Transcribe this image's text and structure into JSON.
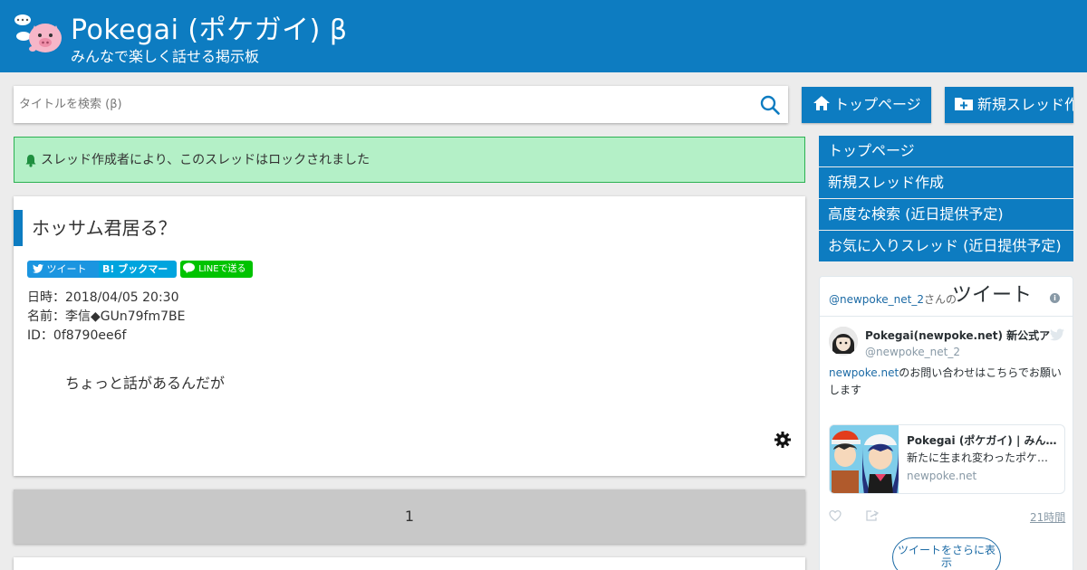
{
  "header": {
    "title": "Pokegai (ポケガイ) β",
    "subtitle": "みんなで楽しく話せる掲示板"
  },
  "search": {
    "placeholder": "タイトルを検索 (β)"
  },
  "buttons": {
    "top_page": "トップページ",
    "new_thread": "新規スレッド作成"
  },
  "notice": {
    "text": "スレッド作成者により、このスレッドはロックされました",
    "color": "#b4f0c7"
  },
  "thread": {
    "title": "ホッサム君居る？",
    "share": {
      "tweet": "ツイート",
      "bookmark": "B! ブックマーク",
      "line": "LINEで送る"
    },
    "date": "日時：2018/04/05 20:30",
    "name": "名前：李信◆GUn79fm7BE",
    "id": "ID：0f8790ee6f",
    "body": "ちょっと話があるんだが"
  },
  "pagination": {
    "current": "1"
  },
  "sidebar": {
    "items": [
      {
        "label": "トップページ"
      },
      {
        "label": "新規スレッド作成"
      },
      {
        "label": "高度な検索 (近日提供予定)"
      },
      {
        "label": "お気に入りスレッド (近日提供予定)"
      }
    ]
  },
  "twitter": {
    "header_handle": "@newpoke_net_2",
    "header_san": "さんの",
    "header_title": "ツイート",
    "info_icon": "i",
    "author_name": "Pokegai(newpoke.net) 新公式アカウント",
    "author_handle": "@newpoke_net_2",
    "tweet_link": "newpoke.net",
    "tweet_text": "のお問い合わせはこちらでお願いします",
    "card_title": "Pokegai (ポケガイ) | みんなで楽しく話せる掲示板",
    "card_desc": "新たに生まれ変わったポケモン掲示板",
    "card_domain": "newpoke.net",
    "time": "21時間",
    "more_button": "ツイートをさらに表示"
  },
  "colors": {
    "brand": "#0d7cc1",
    "background": "#ececec",
    "notice_border": "#2cb152",
    "pager": "#c8c8c8"
  }
}
